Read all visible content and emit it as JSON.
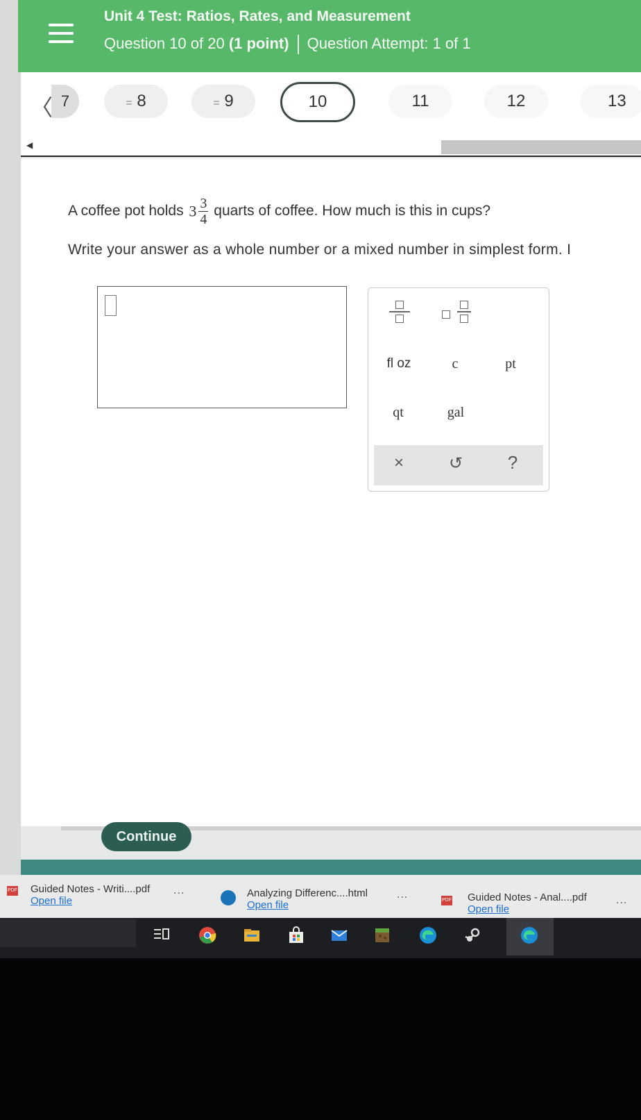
{
  "header": {
    "title": "Unit 4 Test: Ratios, Rates, and Measurement",
    "question_label": "Question 10 of 20",
    "points": "(1 point)",
    "attempt": "Question Attempt: 1 of 1"
  },
  "nav": {
    "prev_number": "7",
    "items": [
      {
        "label": "8",
        "state": "answered"
      },
      {
        "label": "9",
        "state": "answered"
      },
      {
        "label": "10",
        "state": "current"
      },
      {
        "label": "11",
        "state": "unanswered"
      },
      {
        "label": "12",
        "state": "unanswered"
      },
      {
        "label": "13",
        "state": "unanswered"
      }
    ],
    "answered_mark": "="
  },
  "question": {
    "text_before": "A coffee pot holds",
    "mixed_whole": "3",
    "mixed_numerator": "3",
    "mixed_denominator": "4",
    "text_after": "quarts of coffee. How much is this in cups?",
    "instructions": "Write your answer as a whole number or a mixed number in simplest form. I"
  },
  "answer": {
    "value": ""
  },
  "palette": {
    "units": [
      "fl oz",
      "c",
      "pt",
      "qt",
      "gal"
    ],
    "clear_symbol": "×",
    "undo_symbol": "↺",
    "help_symbol": "?"
  },
  "footer": {
    "continue_label": "Continue"
  },
  "downloads": [
    {
      "name": "Guided Notes - Writi....pdf",
      "link": "Open file",
      "type": "pdf"
    },
    {
      "name": "Analyzing Differenc....html",
      "link": "Open file",
      "type": "html"
    },
    {
      "name": "Guided Notes - Anal....pdf",
      "link": "Open file",
      "type": "pdf"
    }
  ],
  "downloads_more": "...",
  "pdf_badge": "PDF",
  "colors": {
    "header_green": "#58b86a",
    "continue_dark_green": "#2b5d52",
    "link_blue": "#1a6ed8"
  }
}
